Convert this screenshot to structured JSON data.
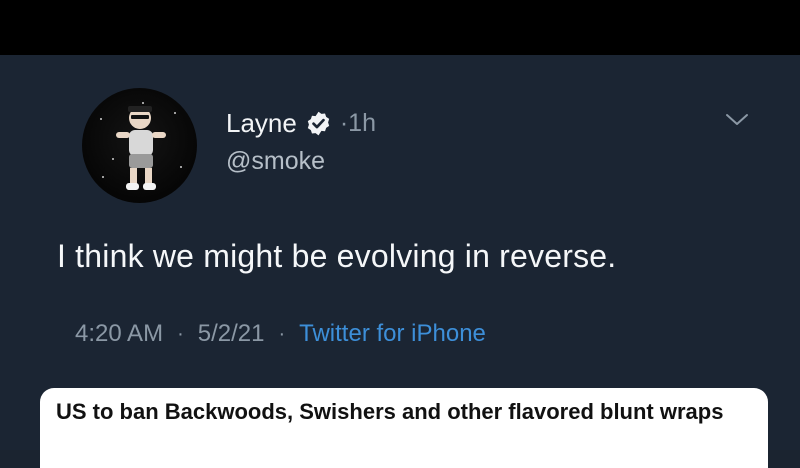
{
  "tweet": {
    "author_name": "Layne",
    "handle": "@smoke",
    "time_ago": "1h",
    "dot": "·",
    "text": "I think we might be evolving in reverse.",
    "time": "4:20 AM",
    "date": "5/2/21",
    "source": "Twitter for iPhone",
    "separator": "·"
  },
  "icons": {
    "verified": "verified-badge-icon",
    "chevron": "chevron-down-icon"
  },
  "card": {
    "title": "US to ban Backwoods, Swishers and other flavored blunt wraps"
  },
  "colors": {
    "background": "#1b2533",
    "link": "#3d8fd9",
    "muted": "#8b98a5"
  }
}
